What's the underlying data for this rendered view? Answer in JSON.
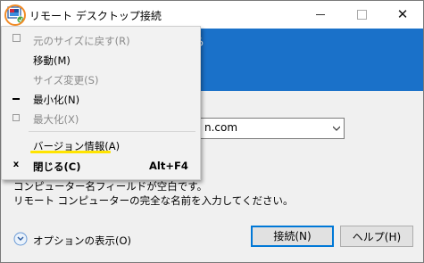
{
  "window": {
    "title": "リモート デスクトップ接続",
    "controls": {
      "minimize": "minimize",
      "maximize": "maximize",
      "close": "✕"
    }
  },
  "banner": {
    "partial_text": "ら"
  },
  "computer_field": {
    "value": "n.com"
  },
  "message": {
    "line1": "コンピューター名フィールドが空白です。",
    "line2": "リモート コンピューターの完全な名前を入力してください。"
  },
  "options_toggle": {
    "label": "オプションの表示(O)"
  },
  "buttons": {
    "connect": "接続(N)",
    "help": "ヘルプ(H)"
  },
  "system_menu": {
    "items": [
      {
        "label": "元のサイズに戻す(R)",
        "icon": "restore-icon",
        "enabled": false
      },
      {
        "label": "移動(M)",
        "enabled": true
      },
      {
        "label": "サイズ変更(S)",
        "enabled": false
      },
      {
        "label": "最小化(N)",
        "icon": "minimize-icon",
        "enabled": true
      },
      {
        "label": "最大化(X)",
        "icon": "maximize-icon",
        "enabled": false
      },
      {
        "label": "バージョン情報(A)",
        "enabled": true,
        "highlighted": true
      },
      {
        "label": "閉じる(C)",
        "icon": "close-icon",
        "icon_glyph": "x",
        "accelerator": "Alt+F4",
        "enabled": true,
        "bold": true
      }
    ]
  },
  "annotations": {
    "highlight_color": "#ffe400",
    "circle_color": "#f28c28"
  },
  "colors": {
    "banner": "#1a71c9",
    "accent": "#0078d7",
    "background": "#f0f0f0"
  }
}
